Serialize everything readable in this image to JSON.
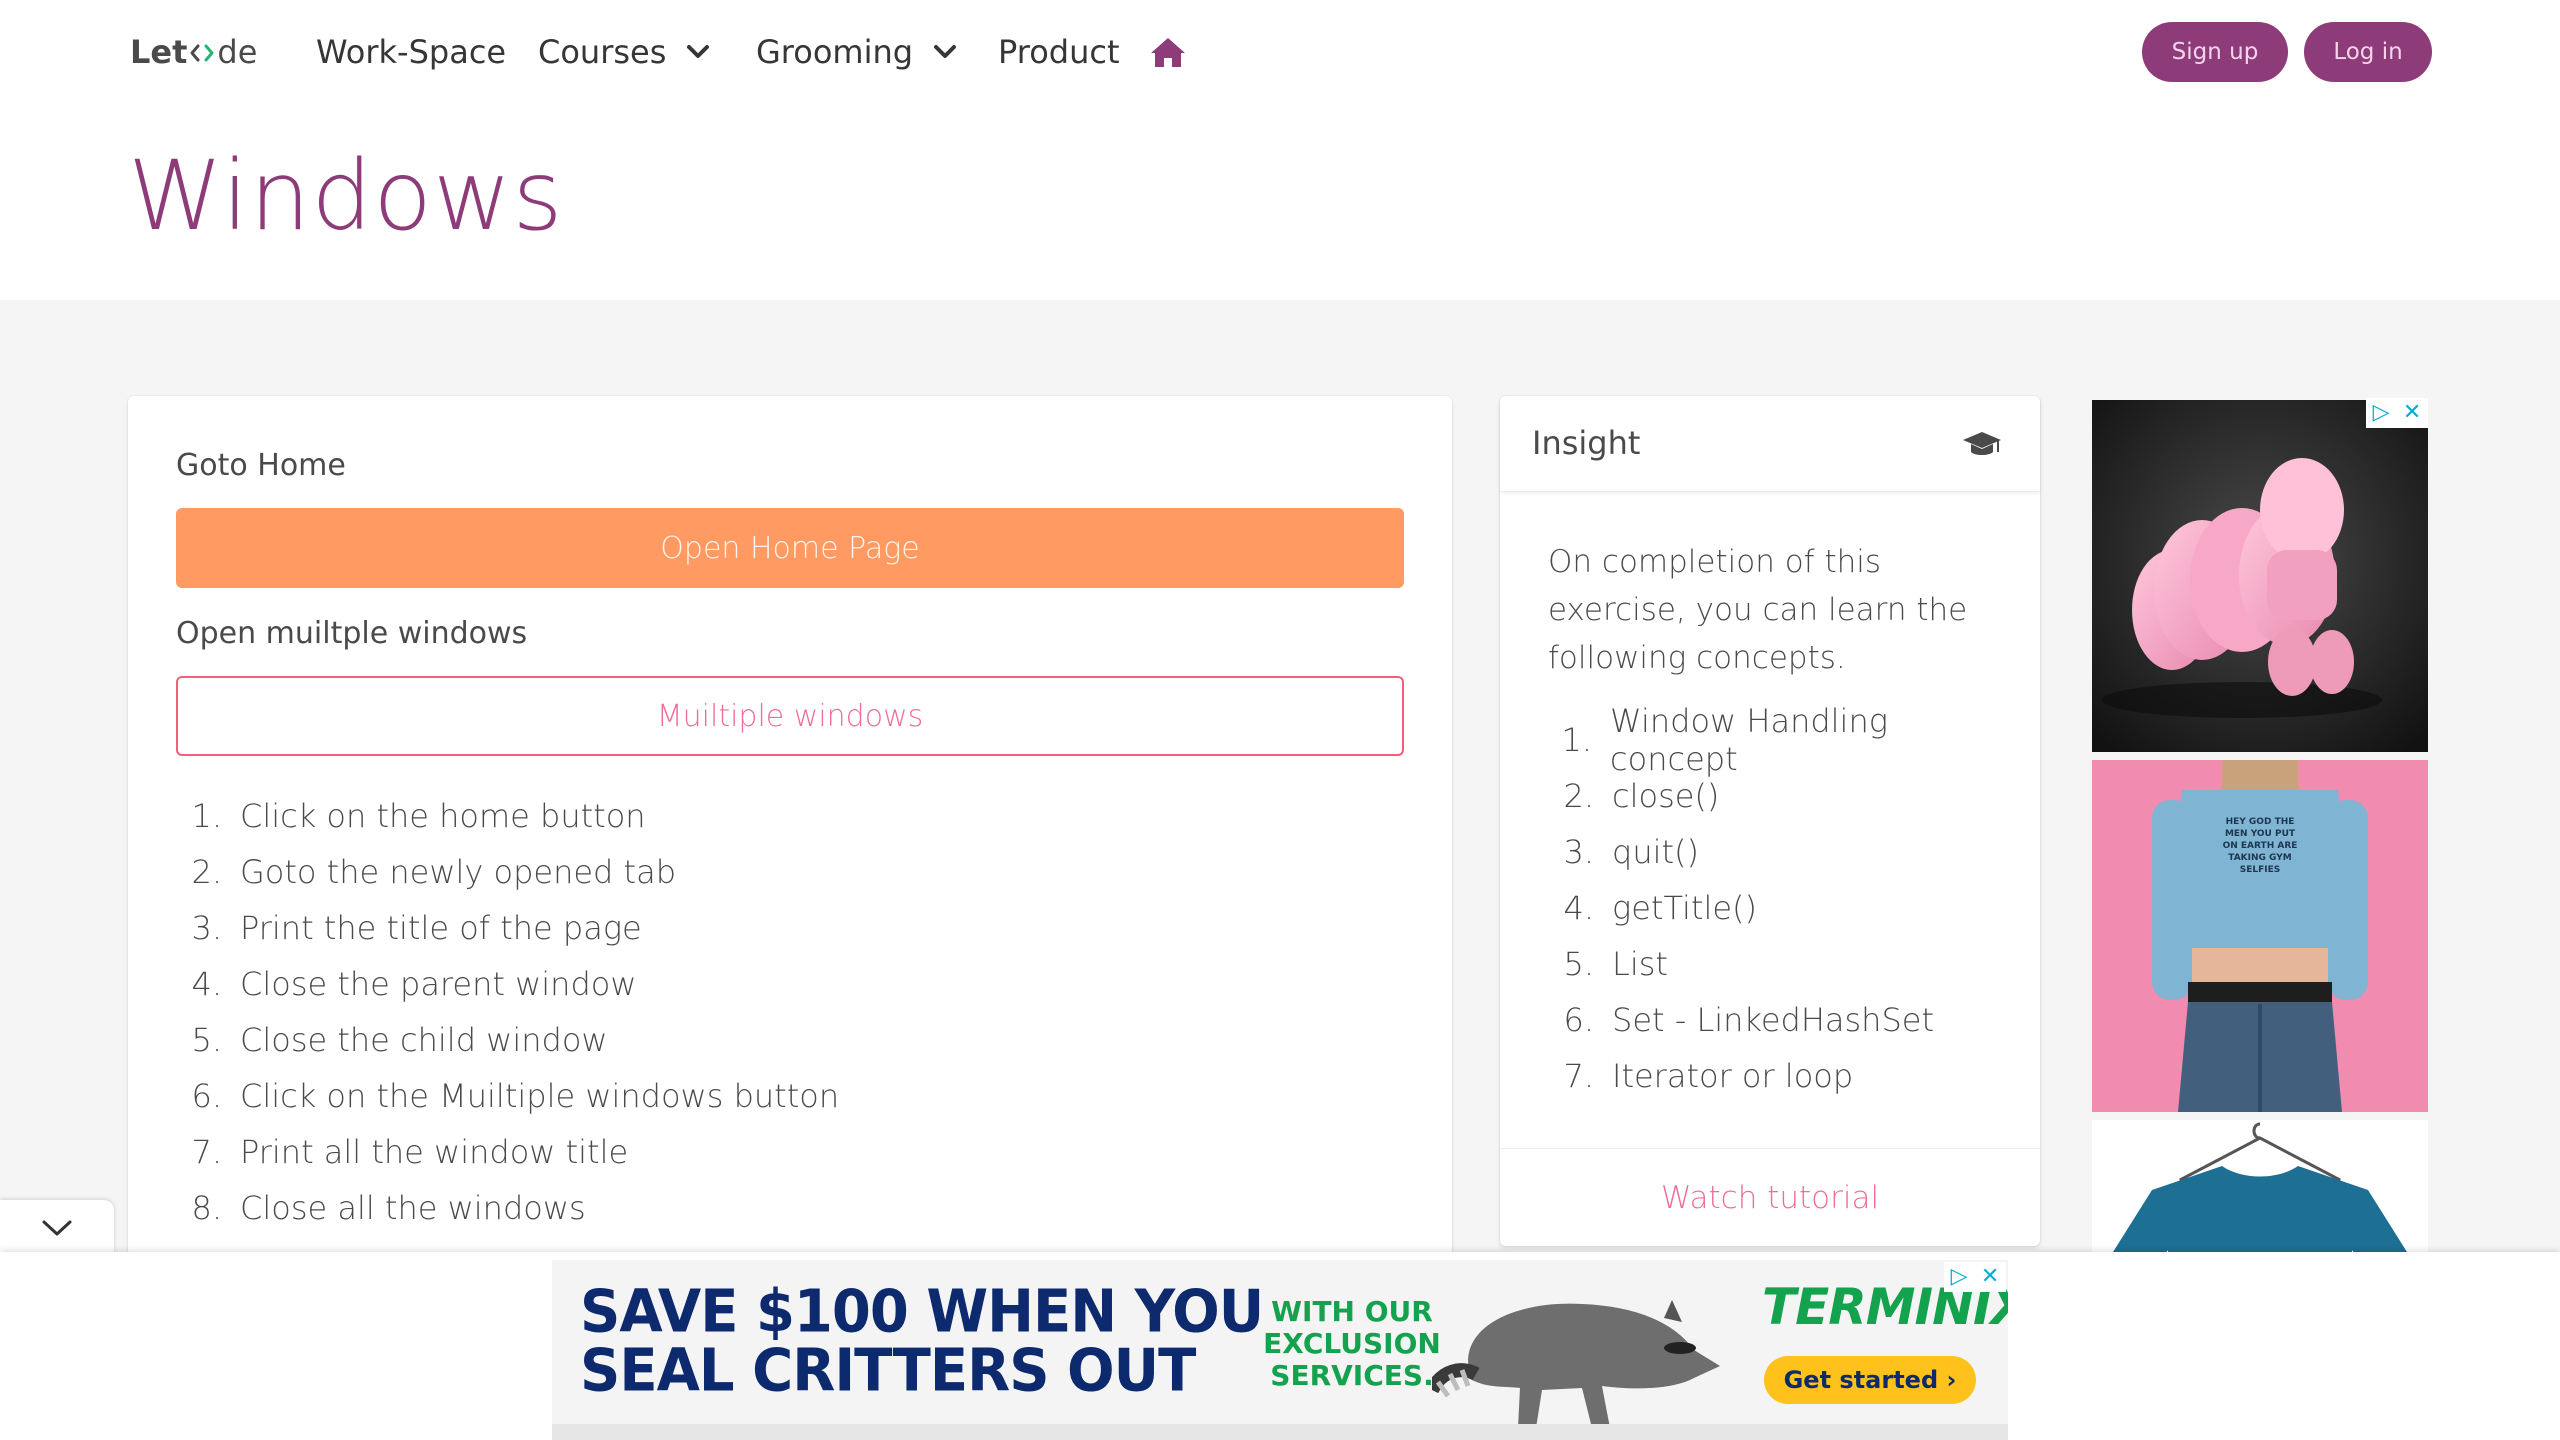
{
  "nav": {
    "logo_prefix": "Let",
    "logo_suffix": "de",
    "items": [
      {
        "label": "Work-Space"
      },
      {
        "label": "Courses"
      },
      {
        "label": "Grooming"
      },
      {
        "label": "Product"
      }
    ],
    "signup_label": "Sign up",
    "login_label": "Log in"
  },
  "page": {
    "title": "Windows"
  },
  "main": {
    "goto_home_label": "Goto Home",
    "open_home_button": "Open Home Page",
    "multiple_label": "Open muiltple windows",
    "multiple_button": "Muiltiple windows",
    "steps": [
      "Click on the home button",
      "Goto the newly opened tab",
      "Print the title of the page",
      "Close the parent window",
      "Close the child window",
      "Click on the Muiltiple windows button",
      "Print all the window title",
      "Close all the windows"
    ]
  },
  "insight": {
    "title": "Insight",
    "intro": "On completion of this exercise, you can learn the following concepts.",
    "concepts": [
      "Window Handling concept",
      "close()",
      "quit()",
      "getTitle()",
      "List",
      "Set - LinkedHashSet",
      "Iterator or loop"
    ],
    "footer_link": "Watch tutorial"
  },
  "side_ads": {
    "tshirt_text": "HEY GOD THE MEN YOU PUT ON EARTH ARE TAKING GYM SELFIES"
  },
  "bottom_ad": {
    "headline_line1": "SAVE $100 WHEN YOU",
    "headline_line2": "SEAL CRITTERS OUT",
    "sub_line1": "WITH OUR",
    "sub_line2": "EXCLUSION",
    "sub_line3": "SERVICES.",
    "brand": "TERMINIX.",
    "cta": "Get started ›"
  },
  "colors": {
    "brand_purple": "#8e3b7a",
    "orange_button": "#ff9b62",
    "pink_accent": "#f26c9a",
    "ad_blue": "#00aecd"
  },
  "icons": {
    "home": "home-icon",
    "cap": "graduation-cap-icon",
    "chevron": "chevron-down-icon"
  }
}
